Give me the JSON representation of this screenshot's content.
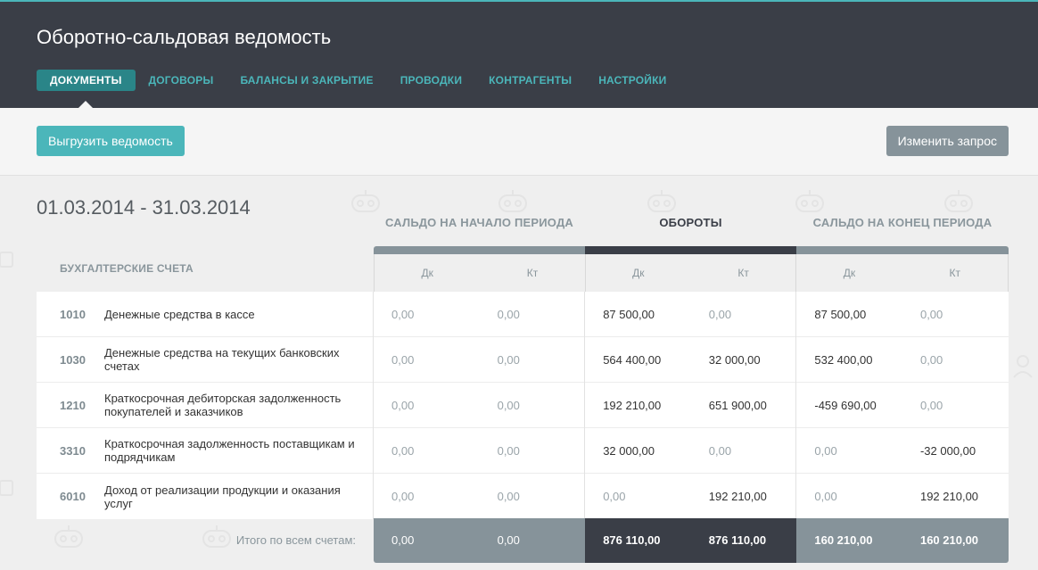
{
  "header": {
    "title": "Оборотно-сальдовая ведомость",
    "nav": [
      {
        "label": "ДОКУМЕНТЫ",
        "active": true
      },
      {
        "label": "ДОГОВОРЫ",
        "active": false
      },
      {
        "label": "БАЛАНСЫ И ЗАКРЫТИЕ",
        "active": false
      },
      {
        "label": "ПРОВОДКИ",
        "active": false
      },
      {
        "label": "КОНТРАГЕНТЫ",
        "active": false
      },
      {
        "label": "НАСТРОЙКИ",
        "active": false
      }
    ]
  },
  "toolbar": {
    "export_label": "Выгрузить ведомость",
    "modify_label": "Изменить запрос"
  },
  "report": {
    "period": "01.03.2014 - 31.03.2014",
    "accounts_header": "БУХГАЛТЕРСКИЕ СЧЕТА",
    "groups": {
      "start": "САЛЬДО НА НАЧАЛО ПЕРИОДА",
      "turnover": "ОБОРОТЫ",
      "end": "САЛЬДО НА КОНЕЦ ПЕРИОДА"
    },
    "sub_headers": [
      "Дк",
      "Кт",
      "Дк",
      "Кт",
      "Дк",
      "Кт"
    ],
    "rows": [
      {
        "code": "1010",
        "name": "Денежные средства в кассе",
        "values": [
          "0,00",
          "0,00",
          "87 500,00",
          "0,00",
          "87 500,00",
          "0,00"
        ]
      },
      {
        "code": "1030",
        "name": "Денежные средства на текущих банковских счетах",
        "values": [
          "0,00",
          "0,00",
          "564 400,00",
          "32 000,00",
          "532 400,00",
          "0,00"
        ]
      },
      {
        "code": "1210",
        "name": "Краткосрочная дебиторская задолженность покупателей и заказчиков",
        "values": [
          "0,00",
          "0,00",
          "192 210,00",
          "651 900,00",
          "-459 690,00",
          "0,00"
        ]
      },
      {
        "code": "3310",
        "name": "Краткосрочная задолженность поставщикам и подрядчикам",
        "values": [
          "0,00",
          "0,00",
          "32 000,00",
          "0,00",
          "0,00",
          "-32 000,00"
        ]
      },
      {
        "code": "6010",
        "name": "Доход от реализации продукции и оказания услуг",
        "values": [
          "0,00",
          "0,00",
          "0,00",
          "192 210,00",
          "0,00",
          "192 210,00"
        ]
      }
    ],
    "total_label": "Итого по всем счетам:",
    "totals": [
      "0,00",
      "0,00",
      "876 110,00",
      "876 110,00",
      "160 210,00",
      "160 210,00"
    ]
  },
  "colors": {
    "header_bg": "#3a3e47",
    "accent": "#4bb6ba",
    "active_tab": "#2a8588",
    "gray_button": "#86939a"
  }
}
